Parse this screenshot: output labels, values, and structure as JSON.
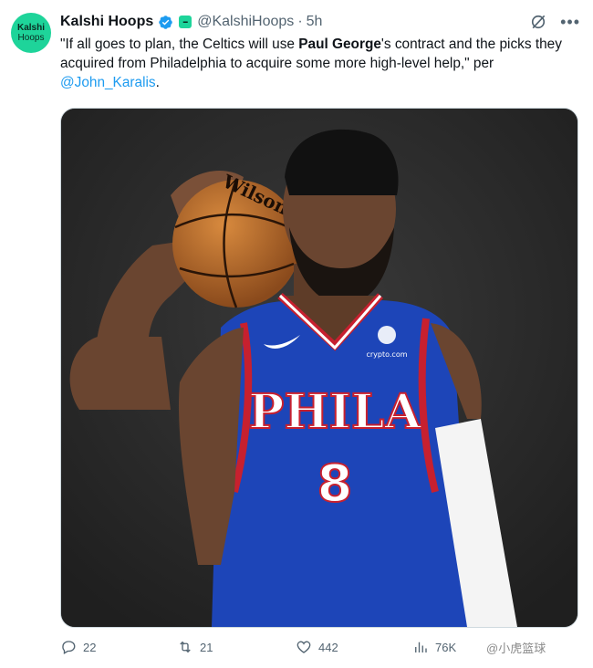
{
  "account": {
    "avatar_line1": "Kalshi",
    "avatar_line2": "Hoops",
    "display_name": "Kalshi Hoops",
    "handle": "@KalshiHoops",
    "separator": "·",
    "time": "5h"
  },
  "tweet": {
    "text_part1": "\"If all goes to plan, the Celtics will use ",
    "bold_name": "Paul George",
    "text_part2": "'s contract and the picks they acquired from Philadelphia to acquire some more high-level help,\" per ",
    "mention": "@John_Karalis",
    "text_end": "."
  },
  "media": {
    "ball_brand": "Wilson",
    "jersey_text": "PHILA",
    "jersey_number": "8",
    "sponsor": "crypto.com",
    "background_color": "#2b2b2b",
    "jersey_color": "#1d45b8"
  },
  "actions": {
    "replies": "22",
    "retweets": "21",
    "likes": "442",
    "views": "76K"
  },
  "watermark": "@小虎篮球",
  "icons": [
    "verified-badge-icon",
    "affiliate-badge-icon",
    "grok-icon",
    "more-icon",
    "reply-icon",
    "retweet-icon",
    "like-icon",
    "views-icon"
  ]
}
